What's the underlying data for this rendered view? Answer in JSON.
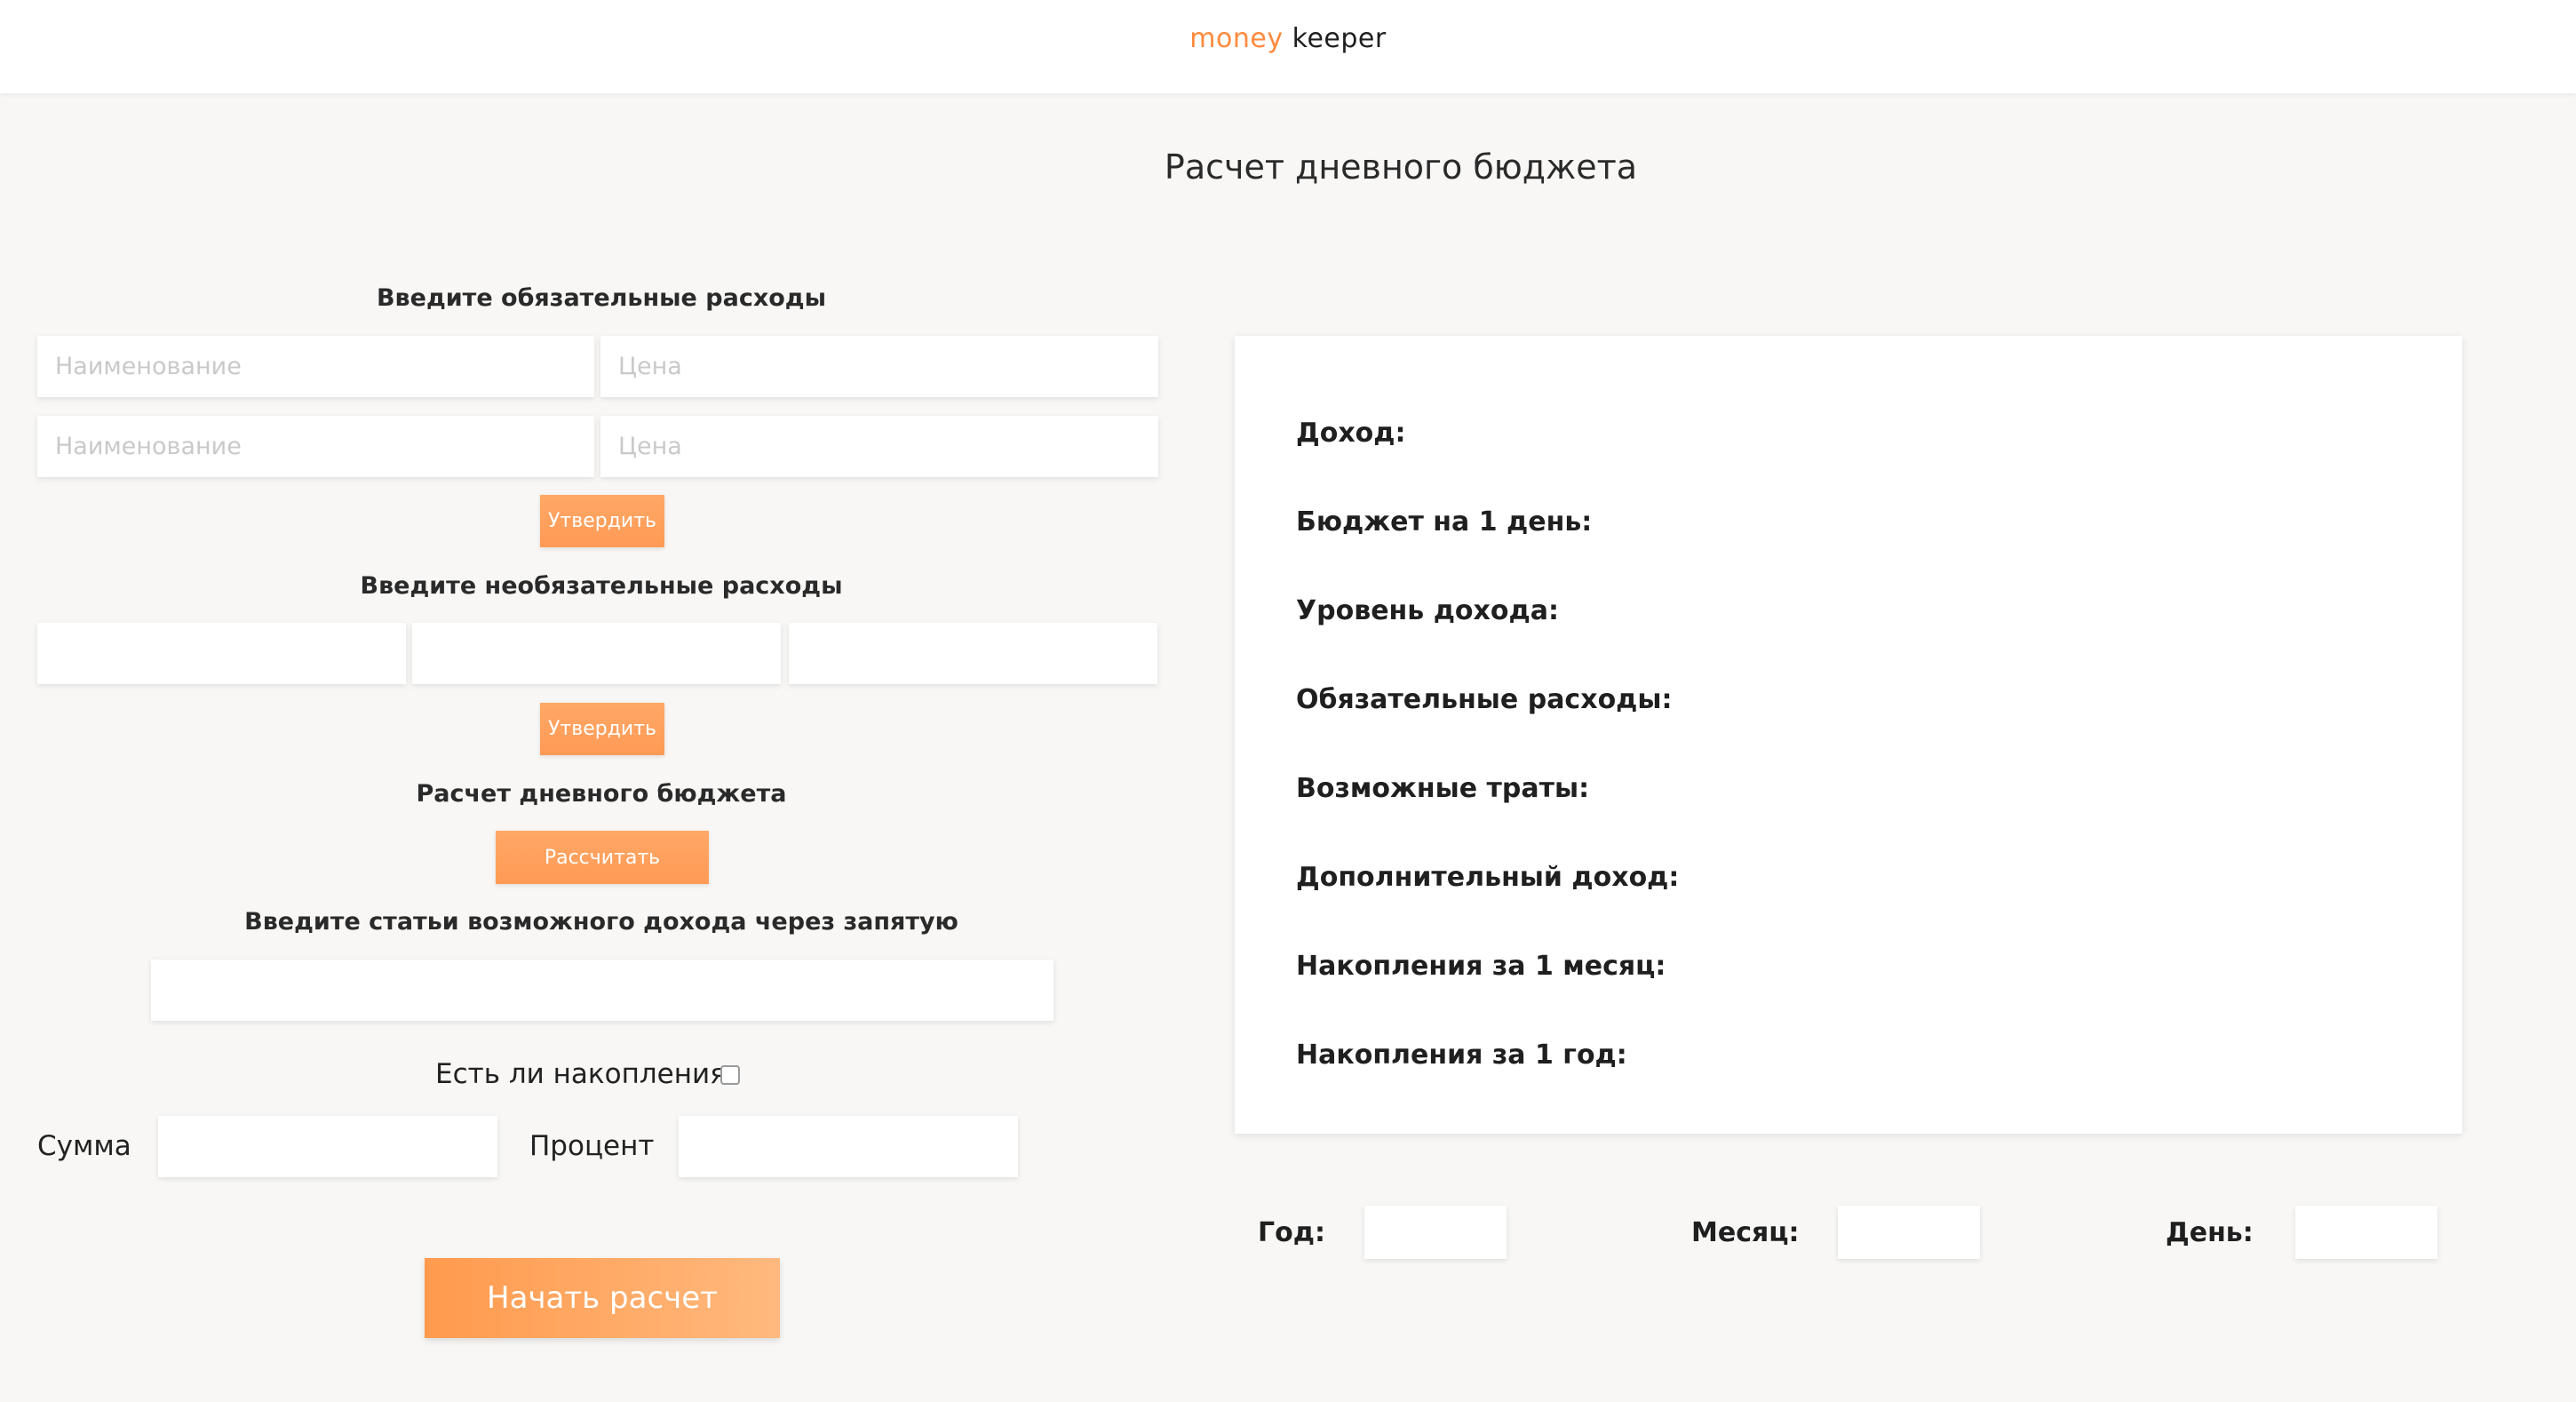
{
  "header": {
    "logo_part1": "money",
    "logo_part2": "keeper"
  },
  "page_title": "Расчет дневного бюджета",
  "mandatory": {
    "label": "Введите обязательные расходы",
    "rows": [
      {
        "name_placeholder": "Наименование",
        "price_placeholder": "Цена"
      },
      {
        "name_placeholder": "Наименование",
        "price_placeholder": "Цена"
      }
    ],
    "confirm_label": "Утвердить"
  },
  "optional": {
    "label": "Введите необязательные расходы",
    "confirm_label": "Утвердить"
  },
  "daily": {
    "label": "Расчет дневного бюджета",
    "calc_label": "Рассчитать"
  },
  "income": {
    "label": "Введите статьи возможного дохода через запятую"
  },
  "savings": {
    "label": "Есть ли накопления:",
    "sum_label": "Сумма",
    "percent_label": "Процент"
  },
  "start_label": "Начать расчет",
  "results": [
    "Доход:",
    "Бюджет на 1 день:",
    "Уровень дохода:",
    "Обязательные расходы:",
    "Возможные траты:",
    "Дополнительный доход:",
    "Накопления за 1 месяц:",
    "Накопления за 1 год:"
  ],
  "date": {
    "year_label": "Год:",
    "month_label": "Месяц:",
    "day_label": "День:"
  },
  "colors": {
    "accent": "#ff9a55",
    "background": "#f8f7f5"
  }
}
